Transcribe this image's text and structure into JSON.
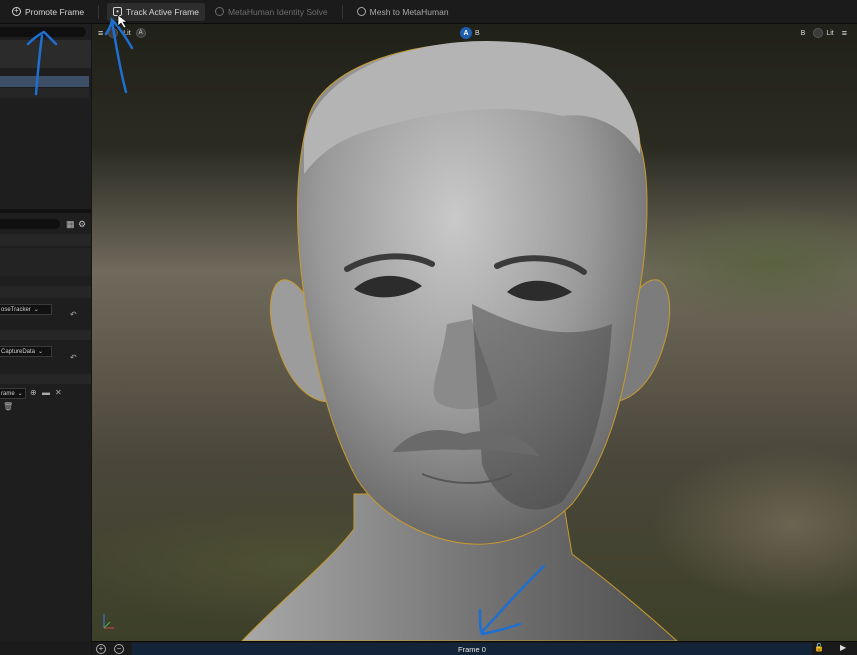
{
  "toolbar": {
    "promote_frame": "Promote Frame",
    "track_active_frame": "Track Active Frame",
    "identity_solve": "MetaHuman Identity Solve",
    "mesh_to_metahuman": "Mesh to MetaHuman"
  },
  "left_panel": {
    "tracker_dropdown": "oseTracker",
    "capture_dropdown": "CaptureData",
    "frame_dropdown": "rame"
  },
  "viewport": {
    "lit_label_left": "Lit",
    "camera_a": "A",
    "camera_b": "B",
    "lit_label_right": "Lit",
    "right_b": "B"
  },
  "bottom": {
    "frame_label": "Frame 0"
  },
  "colors": {
    "accent_blue": "#1e5fb0",
    "selection_outline": "#c89a2e",
    "annotation_arrow": "#1f6fd0"
  }
}
